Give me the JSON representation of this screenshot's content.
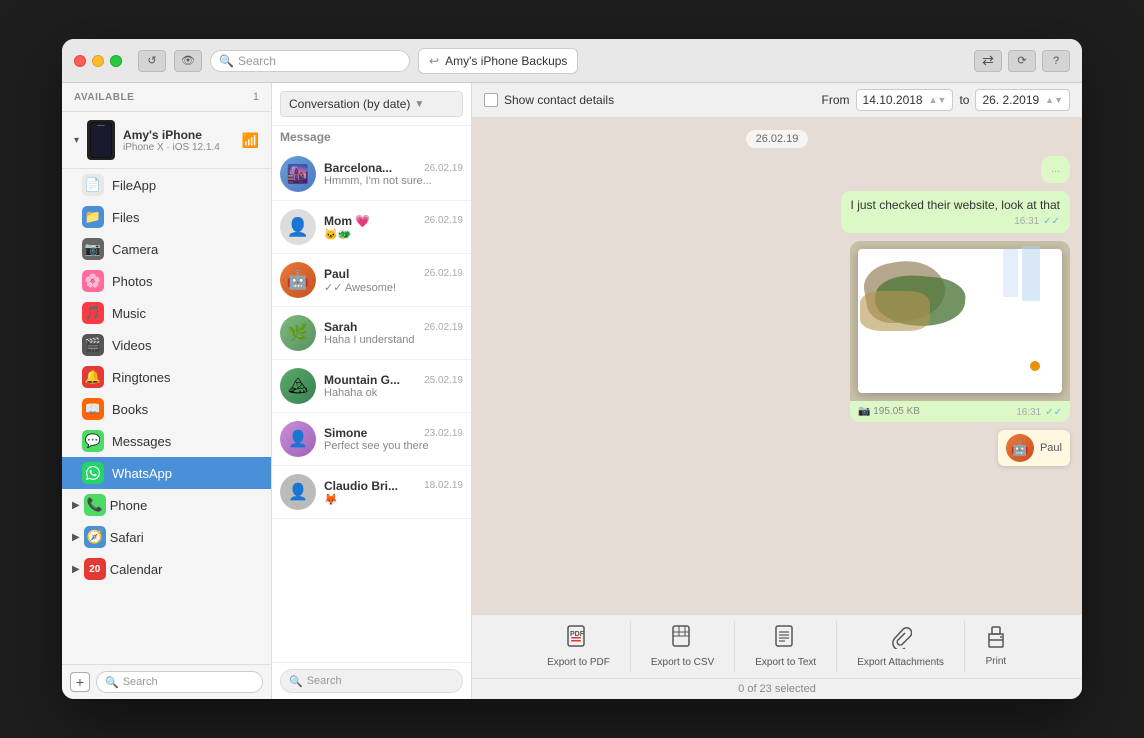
{
  "window": {
    "title": "iPhone Backups"
  },
  "titlebar": {
    "search_placeholder": "Search",
    "device_label": "Amy's iPhone Backups",
    "refresh_icon": "↺",
    "eye_icon": "👁",
    "back_icon": "←",
    "arrows_icon": "⇄",
    "wifi_icon": "wifi",
    "settings_icon": "⚙",
    "help_icon": "?"
  },
  "sidebar": {
    "header_label": "AVAILABLE",
    "header_count": "1",
    "device": {
      "name": "Amy's iPhone",
      "sub": "iPhone X · iOS 12.1.4"
    },
    "items": [
      {
        "id": "fileapp",
        "label": "FileApp",
        "icon": "📄",
        "color": "#e8e8e8"
      },
      {
        "id": "files",
        "label": "Files",
        "icon": "📁",
        "color": "#4a90d9"
      },
      {
        "id": "camera",
        "label": "Camera",
        "icon": "📷",
        "color": "#666"
      },
      {
        "id": "photos",
        "label": "Photos",
        "icon": "🌸",
        "color": "#ff6b9d"
      },
      {
        "id": "music",
        "label": "Music",
        "icon": "🎵",
        "color": "#fc3c44"
      },
      {
        "id": "videos",
        "label": "Videos",
        "icon": "🎬",
        "color": "#555"
      },
      {
        "id": "ringtones",
        "label": "Ringtones",
        "icon": "🔔",
        "color": "#e53935"
      },
      {
        "id": "books",
        "label": "Books",
        "icon": "📖",
        "color": "#ff6600"
      },
      {
        "id": "messages",
        "label": "Messages",
        "icon": "💬",
        "color": "#4cd964"
      },
      {
        "id": "whatsapp",
        "label": "WhatsApp",
        "icon": "💬",
        "color": "#25d366",
        "active": true
      },
      {
        "id": "phone",
        "label": "Phone",
        "icon": "📞",
        "color": "#4cd964",
        "expandable": true
      },
      {
        "id": "safari",
        "label": "Safari",
        "icon": "🧭",
        "color": "#4a90d9",
        "expandable": true
      },
      {
        "id": "calendar",
        "label": "Calendar",
        "icon": "📅",
        "color": "#e53935",
        "expandable": true
      }
    ],
    "search_placeholder": "Search",
    "add_label": "+"
  },
  "conversations": {
    "filter_label": "Conversation (by date)",
    "message_label": "Message",
    "items": [
      {
        "id": "barcelona",
        "name": "Barcelona...",
        "date": "26.02.19",
        "preview": "Hmmm, I'm not sure...",
        "avatar_type": "photo",
        "avatar_emoji": "🌆"
      },
      {
        "id": "mom",
        "name": "Mom 💗",
        "date": "26.02.19",
        "preview": "🐱🐲",
        "avatar_type": "generic"
      },
      {
        "id": "paul",
        "name": "Paul",
        "date": "26.02.19",
        "preview": "✓✓ Awesome!",
        "avatar_type": "futurama"
      },
      {
        "id": "sarah",
        "name": "Sarah",
        "date": "26.02.19",
        "preview": "Haha I understand",
        "avatar_type": "photo"
      },
      {
        "id": "mountain",
        "name": "Mountain G...",
        "date": "25.02.19",
        "preview": "Hahaha ok",
        "avatar_type": "photo"
      },
      {
        "id": "simone",
        "name": "Simone",
        "date": "23.02.19",
        "preview": "Perfect see you there",
        "avatar_type": "photo"
      },
      {
        "id": "claudio",
        "name": "Claudio Bri...",
        "date": "18.02.19",
        "preview": "🦊",
        "avatar_type": "generic"
      }
    ],
    "search_placeholder": "Search"
  },
  "messages": {
    "show_contact_label": "Show contact details",
    "from_label": "From",
    "to_label": "to",
    "from_date": "14.10.2018",
    "to_date": "26. 2.2019",
    "date_bubble": "26.02.19",
    "msg1": {
      "text": "I just checked their website, look at that",
      "time": "16:31",
      "type": "sent"
    },
    "img1": {
      "size": "195.05 KB",
      "time": "16:31",
      "type": "sent"
    },
    "sender_tag": "Paul",
    "status_text": "0 of 23 selected"
  },
  "export": {
    "pdf_label": "Export to PDF",
    "csv_label": "Export to CSV",
    "text_label": "Export to Text",
    "attachments_label": "Export Attachments",
    "print_label": "Print"
  }
}
